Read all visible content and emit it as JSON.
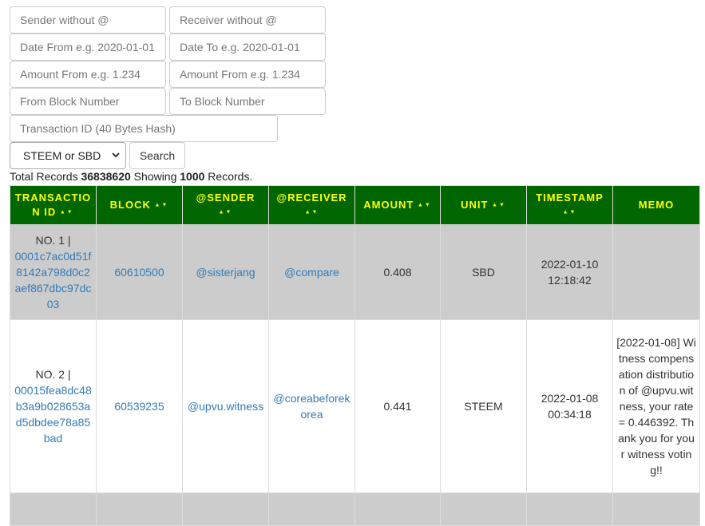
{
  "filters": {
    "sender_placeholder": "Sender without @",
    "receiver_placeholder": "Receiver without @",
    "date_from_placeholder": "Date From e.g. 2020-01-01",
    "date_to_placeholder": "Date To e.g. 2020-01-01",
    "amount_from_placeholder": "Amount From e.g. 1.234",
    "amount_to_placeholder": "Amount From e.g. 1.234",
    "block_from_placeholder": "From Block Number",
    "block_to_placeholder": "To Block Number",
    "tx_id_placeholder": "Transaction ID (40 Bytes Hash)",
    "unit_select": "STEEM or SBD",
    "search_label": "Search"
  },
  "summary": {
    "prefix": "Total Records ",
    "total": "36838620",
    "middle": " Showing ",
    "showing": "1000",
    "suffix": " Records."
  },
  "table": {
    "headers": {
      "tx_id": "TRANSACTIO N ID",
      "block": "BLOCK",
      "sender": "@SENDER",
      "receiver": "@RECEIVER",
      "amount": "AMOUNT",
      "unit": "UNIT",
      "timestamp": "TIMESTAMP",
      "memo": "MEMO"
    },
    "sort_glyph": "▲▼",
    "rows": [
      {
        "no": "NO. 1 |",
        "tx_id": "0001c7ac0d51f8142a798d0c2aef867dbc97dc03",
        "block": "60610500",
        "sender": "@sisterjang",
        "receiver": "@compare",
        "amount": "0.408",
        "unit": "SBD",
        "timestamp": "2022-01-10 12:18:42",
        "memo": ""
      },
      {
        "no": "NO. 2 |",
        "tx_id": "00015fea8dc48b3a9b028653ad5dbdee78a85bad",
        "block": "60539235",
        "sender": "@upvu.witness",
        "receiver": "@coreabeforekorea",
        "amount": "0.441",
        "unit": "STEEM",
        "timestamp": "2022-01-08 00:34:18",
        "memo": "[2022-01-08] Witness compensation distribution of @upvu.witness, your rate = 0.446392. Thank you for your witness voting!!"
      }
    ]
  }
}
